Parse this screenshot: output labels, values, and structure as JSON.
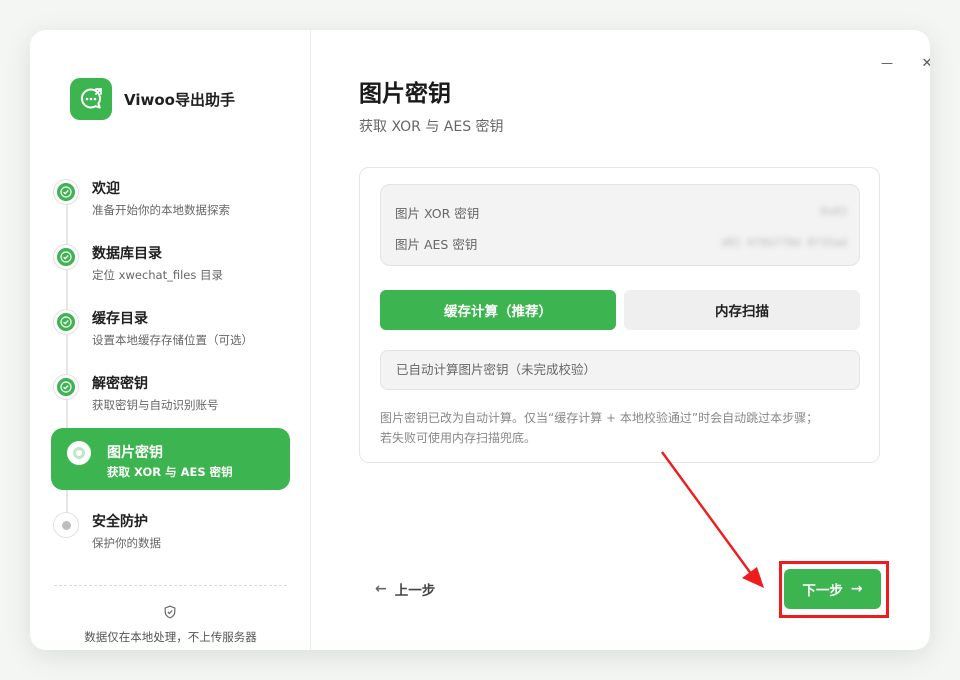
{
  "brand": {
    "name": "Viwoo导出助手",
    "icon": "chat-bubble-export-icon"
  },
  "window_controls": {
    "minimize": "—",
    "close": "✕"
  },
  "steps": [
    {
      "title": "欢迎",
      "subtitle": "准备开始你的本地数据探索",
      "state": "done"
    },
    {
      "title": "数据库目录",
      "subtitle": "定位 xwechat_files 目录",
      "state": "done"
    },
    {
      "title": "缓存目录",
      "subtitle": "设置本地缓存存储位置（可选）",
      "state": "done"
    },
    {
      "title": "解密密钥",
      "subtitle": "获取密钥与自动识别账号",
      "state": "done"
    },
    {
      "title": "图片密钥",
      "subtitle": "获取 XOR 与 AES 密钥",
      "state": "active"
    },
    {
      "title": "安全防护",
      "subtitle": "保护你的数据",
      "state": "pending"
    }
  ],
  "privacy_note": "数据仅在本地处理，不上传服务器",
  "page": {
    "title": "图片密钥",
    "subtitle": "获取 XOR 与 AES 密钥"
  },
  "keys": {
    "xor_label": "图片 XOR 密钥",
    "xor_value": "0x03",
    "aes_label": "图片 AES 密钥",
    "aes_value": "d81 6f6b778d 8f35ad"
  },
  "modes": {
    "primary": "缓存计算（推荐）",
    "secondary": "内存扫描"
  },
  "status": "已自动计算图片密钥（未完成校验）",
  "hint_line1": "图片密钥已改为自动计算。仅当“缓存计算 + 本地校验通过”时会自动跳过本步骤；",
  "hint_line2": "若失败可使用内存扫描兜底。",
  "nav": {
    "back_label": "上一步",
    "next_label": "下一步",
    "back_arrow": "←",
    "next_arrow": "→"
  },
  "colors": {
    "accent": "#3cb450",
    "annotation": "#ee1c1c"
  }
}
